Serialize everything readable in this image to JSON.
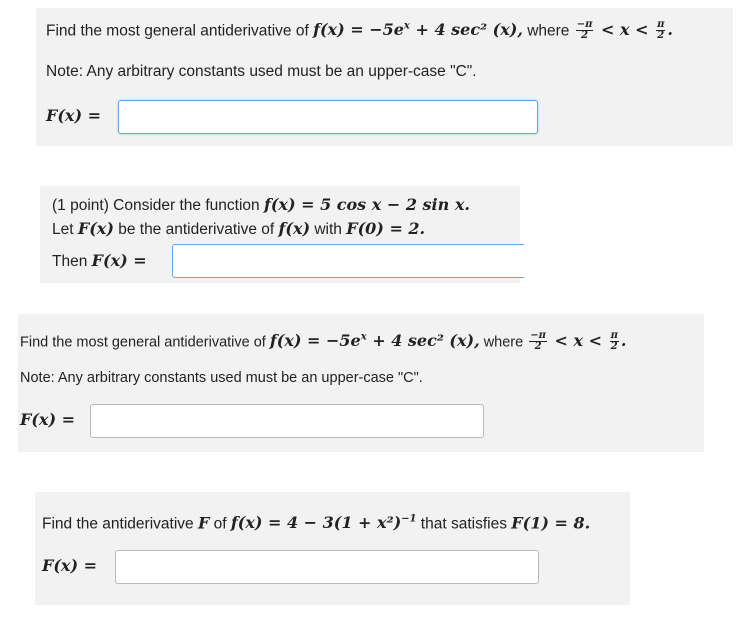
{
  "problems": [
    {
      "intro": "Find the most general antiderivative of",
      "func": "f(x) = −5e",
      "sup": "x",
      "func_tail": " + 4 sec² (x),",
      "where": " where ",
      "cond_left": "−π",
      "cond_den": "2",
      "cond_mid": " < x < ",
      "cond_right": "π",
      "note": "Note: Any arbitrary constants used must be an upper-case \"C\".",
      "label": "F(x) =",
      "value": ""
    },
    {
      "prefix": "(1 point) Consider the function ",
      "func": "f(x) = 5 cos x − 2 sin x.",
      "line2_a": "Let ",
      "line2_b": "F(x)",
      "line2_c": " be the antiderivative of ",
      "line2_d": "f(x)",
      "line2_e": " with ",
      "line2_f": "F(0) = 2.",
      "then": "Then ",
      "label": "F(x) =",
      "value": ""
    },
    {
      "intro": "Find the most general antiderivative of",
      "func": "f(x) = −5e",
      "sup": "x",
      "func_tail": " + 4 sec² (x),",
      "where": " where ",
      "cond_left": "−π",
      "cond_den": "2",
      "cond_mid": " < x < ",
      "cond_right": "π",
      "note": "Note: Any arbitrary constants used must be an upper-case \"C\".",
      "label": "F(x) =",
      "value": ""
    },
    {
      "intro": "Find the antiderivative ",
      "F": "F",
      "of": " of ",
      "func": "f(x) = 4 − 3(1 + x²)",
      "sup": "−1",
      "satisfies": " that satisfies ",
      "cond": "F(1) = 8.",
      "label": "F(x) =",
      "value": ""
    }
  ]
}
